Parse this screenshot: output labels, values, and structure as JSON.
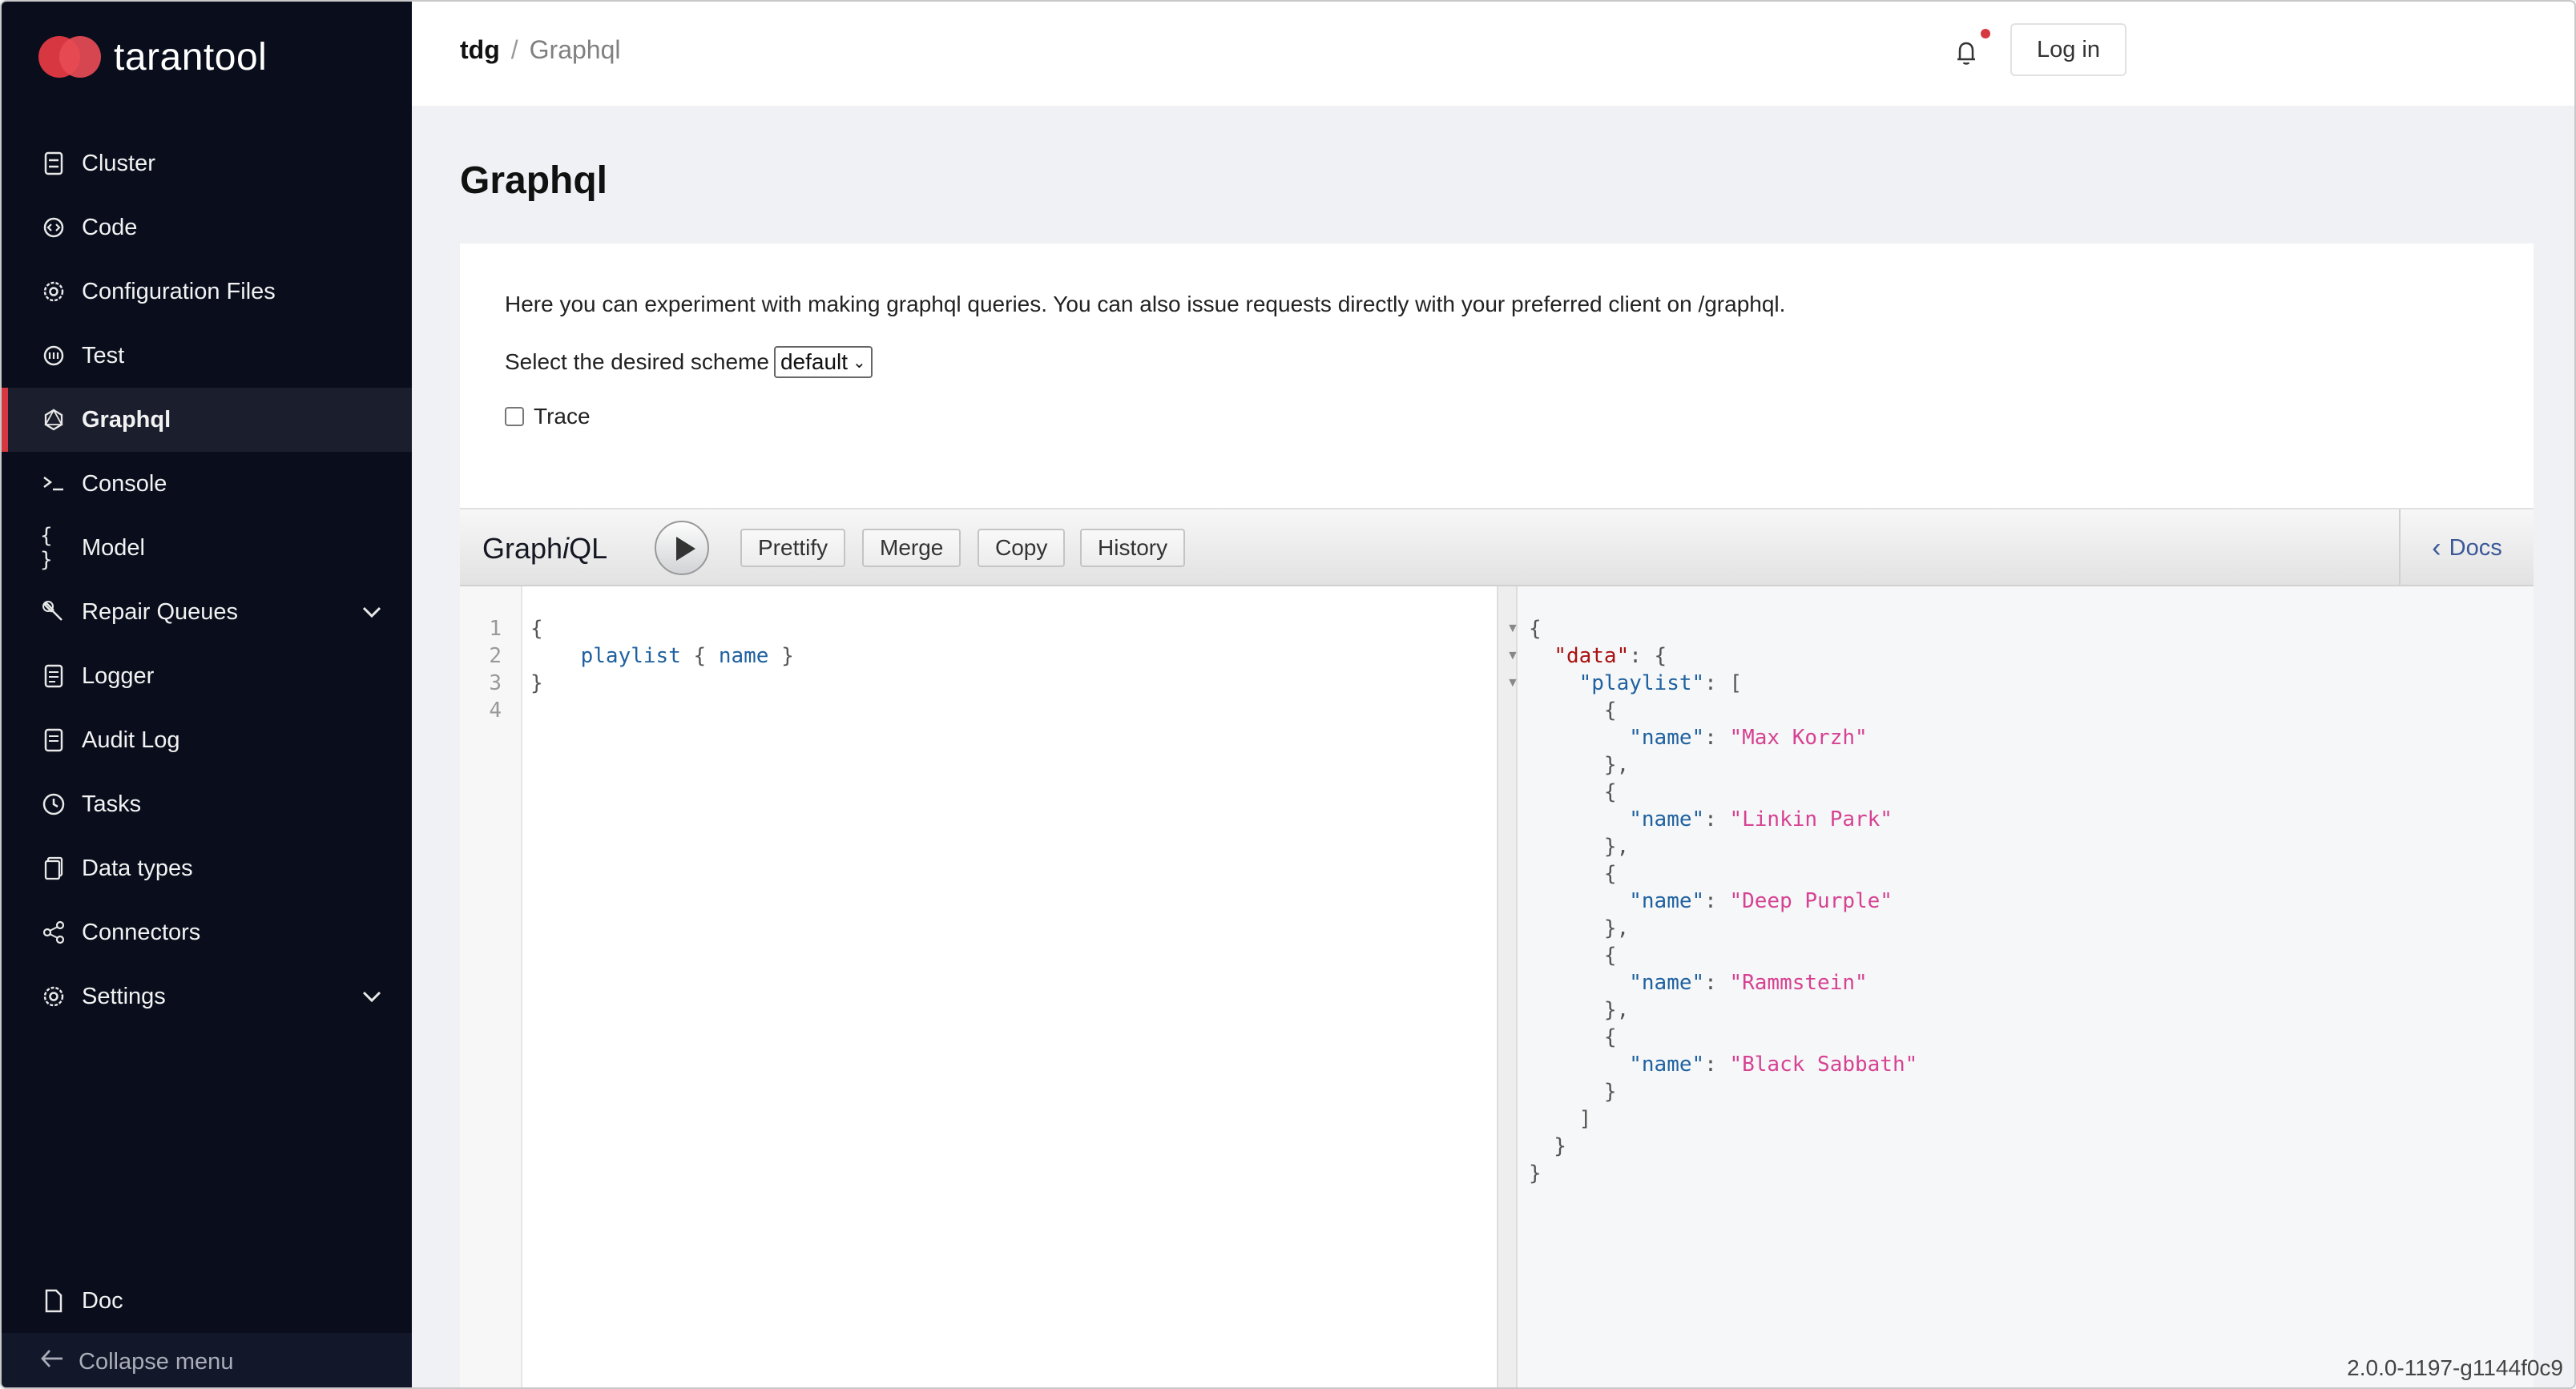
{
  "app": {
    "logo_text": "tarantool"
  },
  "sidebar": {
    "items": [
      {
        "label": "Cluster",
        "icon": "server-icon"
      },
      {
        "label": "Code",
        "icon": "code-icon"
      },
      {
        "label": "Configuration Files",
        "icon": "gear-icon"
      },
      {
        "label": "Test",
        "icon": "test-icon"
      },
      {
        "label": "Graphql",
        "icon": "graphql-icon",
        "active": true
      },
      {
        "label": "Console",
        "icon": "terminal-icon"
      },
      {
        "label": "Model",
        "icon": "braces-icon"
      },
      {
        "label": "Repair Queues",
        "icon": "wrench-icon",
        "expandable": true
      },
      {
        "label": "Logger",
        "icon": "log-icon"
      },
      {
        "label": "Audit Log",
        "icon": "audit-icon"
      },
      {
        "label": "Tasks",
        "icon": "clock-icon"
      },
      {
        "label": "Data types",
        "icon": "datatypes-icon"
      },
      {
        "label": "Connectors",
        "icon": "share-icon"
      },
      {
        "label": "Settings",
        "icon": "settings-icon",
        "expandable": true
      }
    ],
    "doc_label": "Doc",
    "collapse_label": "Collapse menu"
  },
  "header": {
    "breadcrumb_app": "tdg",
    "breadcrumb_sep": "/",
    "breadcrumb_current": "Graphql",
    "login_label": "Log in"
  },
  "page": {
    "title": "Graphql",
    "intro": "Here you can experiment with making graphql queries. You can also issue requests directly with your preferred client on /graphql.",
    "scheme_label": "Select the desired scheme",
    "scheme_value": "default",
    "trace_label": "Trace"
  },
  "graphiql": {
    "title_prefix": "Graph",
    "title_italic": "i",
    "title_suffix": "QL",
    "buttons": [
      "Prettify",
      "Merge",
      "Copy",
      "History"
    ],
    "docs_label": "Docs",
    "query_lines": [
      "1",
      "2",
      "3",
      "4"
    ],
    "query": {
      "open": "{",
      "field": "playlist",
      "sub_open": "{",
      "sub_field": "name",
      "sub_close": "}",
      "close": "}"
    },
    "result": {
      "data_key": "\"data\"",
      "playlist_key": "\"playlist\"",
      "name_key": "\"name\"",
      "names": [
        "\"Max Korzh\"",
        "\"Linkin Park\"",
        "\"Deep Purple\"",
        "\"Rammstein\"",
        "\"Black Sabbath\""
      ]
    }
  },
  "footer": {
    "version": "2.0.0-1197-g1144f0c9"
  },
  "colors": {
    "sidebar_bg": "#0a0e1c",
    "accent": "#d63741",
    "link": "#3b5998",
    "string": "#d64292",
    "field": "#1f61a0"
  }
}
